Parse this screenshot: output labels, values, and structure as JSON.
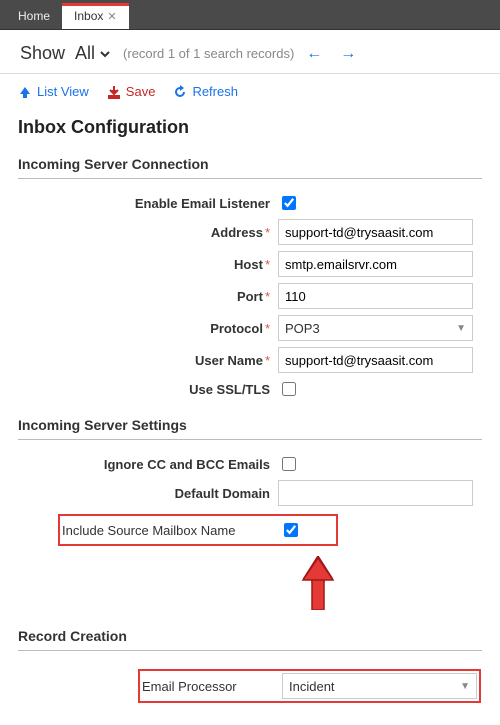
{
  "tabs": {
    "home": "Home",
    "inbox": "Inbox"
  },
  "toolbar": {
    "show": "Show",
    "all": "All",
    "record_count": "(record 1 of 1 search records)"
  },
  "actions": {
    "list_view": "List View",
    "save": "Save",
    "refresh": "Refresh"
  },
  "page_title": "Inbox Configuration",
  "sections": {
    "incoming_conn": "Incoming Server Connection",
    "incoming_settings": "Incoming Server Settings",
    "record_creation": "Record Creation"
  },
  "fields": {
    "enable_listener": {
      "label": "Enable Email Listener",
      "checked": true
    },
    "address": {
      "label": "Address",
      "value": "support-td@trysaasit.com"
    },
    "host": {
      "label": "Host",
      "value": "smtp.emailsrvr.com"
    },
    "port": {
      "label": "Port",
      "value": "110"
    },
    "protocol": {
      "label": "Protocol",
      "value": "POP3"
    },
    "username": {
      "label": "User Name",
      "value": "support-td@trysaasit.com"
    },
    "ssl": {
      "label": "Use SSL/TLS",
      "checked": false
    },
    "ignore_cc": {
      "label": "Ignore CC and BCC Emails",
      "checked": false
    },
    "default_domain": {
      "label": "Default Domain",
      "value": ""
    },
    "include_source": {
      "label": "Include Source Mailbox Name",
      "checked": true
    },
    "email_processor": {
      "label": "Email Processor",
      "value": "Incident"
    }
  }
}
